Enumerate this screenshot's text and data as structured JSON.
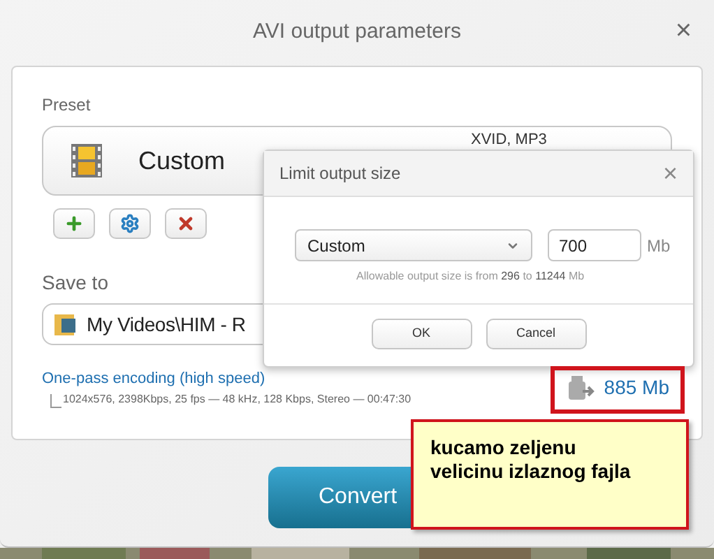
{
  "window": {
    "title": "AVI output parameters",
    "close": "×"
  },
  "preset": {
    "label": "Preset",
    "name": "Custom",
    "codecs": "XVID, MP3"
  },
  "preset_buttons": [
    {
      "kind": "add"
    },
    {
      "kind": "settings"
    },
    {
      "kind": "delete"
    }
  ],
  "save_to": {
    "label": "Save to",
    "path": "My Videos\\HIM - R"
  },
  "encoding": {
    "mode": "One-pass encoding (high speed)",
    "details": "1024x576, 2398Kbps, 25 fps — 48 kHz, 128 Kbps, Stereo — 00:47:30",
    "size": "885 Mb"
  },
  "convert_button": "Convert",
  "limit_dialog": {
    "title": "Limit output size",
    "close": "×",
    "mode": "Custom",
    "value": "700",
    "unit": "Mb",
    "hint": "Allowable output size is from **296** to **11244** Mb",
    "buttons": [
      "OK",
      "Cancel"
    ]
  },
  "note": {
    "text": "kucamo zeljenu velicinu izlaznog fajla"
  }
}
